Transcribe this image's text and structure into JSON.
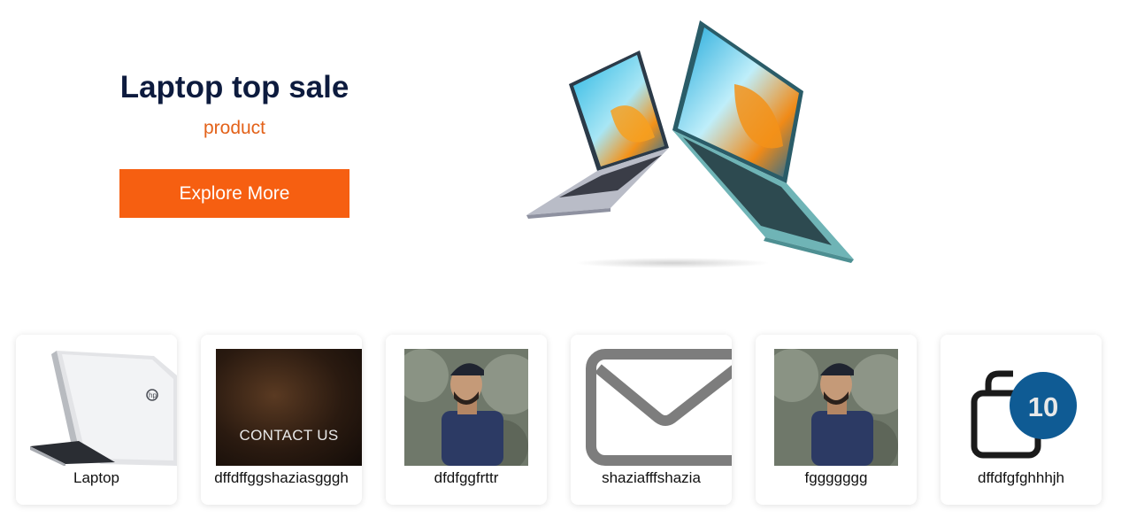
{
  "hero": {
    "title": "Laptop top sale",
    "subtitle": "product",
    "button_label": "Explore More"
  },
  "colors": {
    "title": "#0d1b3e",
    "accent": "#f65f11",
    "subtitle": "#e3621a"
  },
  "categories": [
    {
      "label": "Laptop",
      "image": "laptop-silver"
    },
    {
      "label": "dffdffggshaziasgggh",
      "image": "contact-us-banner",
      "image_text": "CONTACT US"
    },
    {
      "label": "dfdfggfrttr",
      "image": "person-photo"
    },
    {
      "label": "shaziafffshazia",
      "image": "envelope-icon"
    },
    {
      "label": "fggggggg",
      "image": "person-photo"
    },
    {
      "label": "dffdfgfghhhjh",
      "image": "cart-badge-icon",
      "badge": "10"
    }
  ]
}
